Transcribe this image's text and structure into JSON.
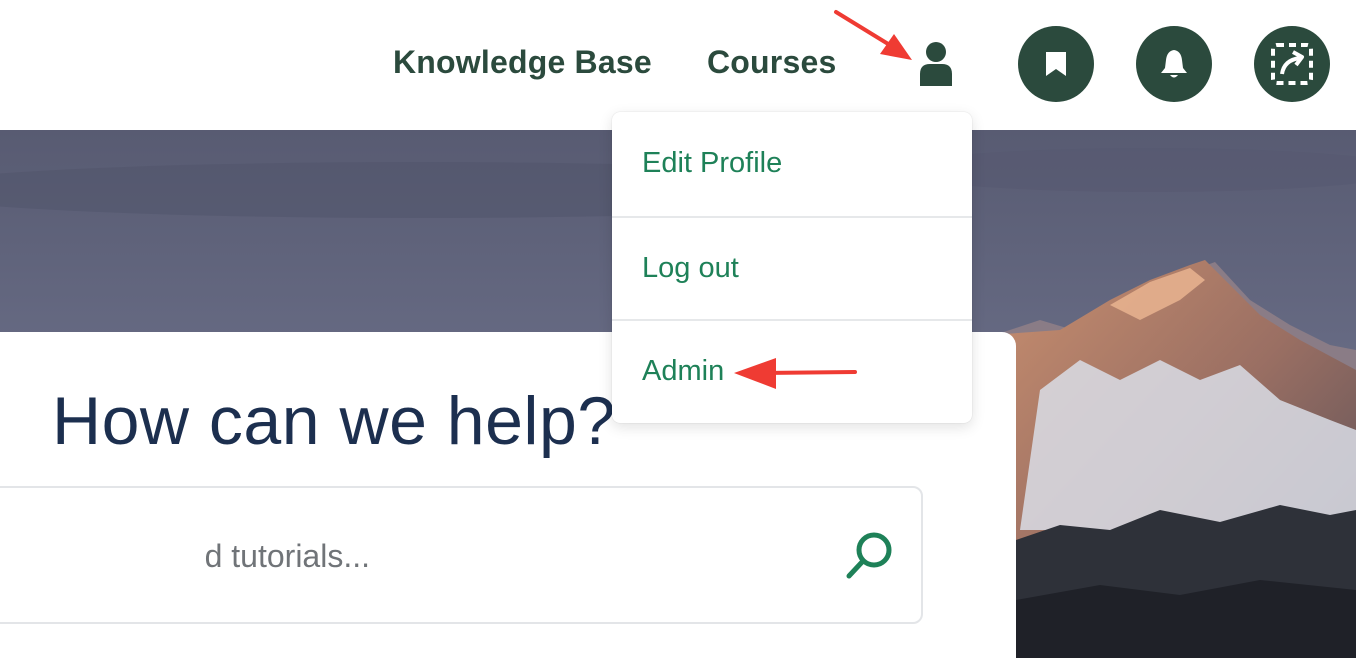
{
  "header": {
    "nav": [
      {
        "label": "Knowledge Base"
      },
      {
        "label": "Courses"
      }
    ],
    "icons": {
      "user": "user-icon",
      "bookmark": "bookmark-icon",
      "bell": "bell-icon",
      "capture": "screen-capture-icon"
    }
  },
  "dropdown": {
    "items": [
      {
        "label": "Edit Profile"
      },
      {
        "label": "Log out"
      },
      {
        "label": "Admin"
      }
    ]
  },
  "help": {
    "title": "How can we help?",
    "search_placeholder": "d tutorials...",
    "search_icon": "search-icon"
  },
  "colors": {
    "brand_dark_green": "#2b4a3d",
    "link_green": "#1e8158",
    "title_navy": "#1c2f4f",
    "annotation_red": "#ef3b33"
  }
}
